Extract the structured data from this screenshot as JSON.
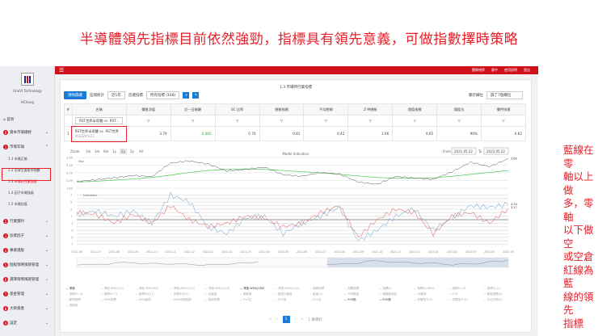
{
  "slide_title": "半導體領先指標目前依然強勁，指標具有領先意義，可做指數擇時策略",
  "annotation": [
    "藍線在零",
    "軸以上做",
    "多，零軸",
    "以下做空",
    "或空倉",
    "紅線為藍",
    "線的領先",
    "指標"
  ],
  "sidebar": {
    "company": "OneVI Technology",
    "user": "HChang",
    "home": "首頁",
    "items": [
      {
        "num": "0",
        "label": "資本市場總經"
      },
      {
        "num": "1",
        "label": "市場年報"
      },
      {
        "num": "2",
        "label": "行業獲利"
      },
      {
        "num": "3",
        "label": "投資因子"
      },
      {
        "num": "4",
        "label": "專業選股"
      },
      {
        "num": "5",
        "label": "個股策略風險管理"
      },
      {
        "num": "6",
        "label": "選擇策略風險管理"
      },
      {
        "num": "7",
        "label": "基金管理"
      },
      {
        "num": "8",
        "label": "大師資產"
      },
      {
        "num": "9",
        "label": "設定"
      }
    ],
    "subitems": [
      "1.1 市場正略",
      "1.2 全球主要股市指數",
      "1.3 市場時行業指標",
      "1.4 因子市場強弱",
      "1.5 市場估值"
    ]
  },
  "topbar": [
    "團隊視界",
    "客中",
    "使用說明",
    "登出"
  ],
  "panel": {
    "title": "1.3 市場時行業指標",
    "filter_button": "清除篩選",
    "period_label": "區間統計",
    "period_value": "近1年",
    "index_label": "首選指標",
    "index_value": "所有指標 (168)",
    "display_label": "顯示欄位",
    "display_value": "篩了7個欄位"
  },
  "table": {
    "headers": [
      "#",
      "名稱",
      "價格淨值",
      "近一日報酬",
      "SC 比率",
      "總報指標",
      "平均總報",
      "Z-M總報",
      "穩值指標",
      "擅值位",
      "擺件指標"
    ],
    "filter_value": "RST世界半導體 vs. RST...",
    "row": {
      "index": "1",
      "name": "RST世界半導體 vs. RST世界",
      "date": "2023/05/22",
      "values": [
        "3.79",
        "0.085",
        "0.70",
        "0.81",
        "0.42",
        "1.06",
        "0.65",
        "90%",
        "0.62"
      ]
    }
  },
  "chart_toolbar": {
    "zoom_label": "Zoom",
    "ranges": [
      "1m",
      "3m",
      "6m",
      "1y",
      "2y",
      "3y",
      "All"
    ],
    "title": "Model Indicators",
    "from_label": "From",
    "from": "2021.05.22",
    "to_label": "To",
    "to": "2023.05.22"
  },
  "chart_data": {
    "type": "line",
    "x": [
      "2021-06",
      "2021-07",
      "2021-08",
      "2021-09",
      "2021-10",
      "2021-11",
      "2021-12",
      "2022-01",
      "2022-02",
      "2022-03",
      "2022-04",
      "2022-05",
      "2022-06",
      "2022-07",
      "2022-08",
      "2022-09",
      "2022-10",
      "2022-11",
      "2022-12",
      "2023-01",
      "2023-02",
      "2023-03",
      "2023-04",
      "2023-05"
    ],
    "nav_label": "Nav",
    "nav_yticks": [
      "2.69",
      "2.49",
      "2.29",
      "2.09",
      "1.89"
    ],
    "nav_ylim": [
      1.89,
      2.69
    ],
    "nav_last": "2.65",
    "nav": [
      2.06,
      2.11,
      2.16,
      2.22,
      2.19,
      2.55,
      2.6,
      2.52,
      2.34,
      2.38,
      2.44,
      2.24,
      2.2,
      2.3,
      2.26,
      2.05,
      1.99,
      2.2,
      2.15,
      2.12,
      2.32,
      2.57,
      2.45,
      2.66
    ],
    "nav_ma": [
      2.05,
      2.07,
      2.1,
      2.13,
      2.17,
      2.23,
      2.3,
      2.35,
      2.38,
      2.39,
      2.38,
      2.35,
      2.32,
      2.29,
      2.25,
      2.21,
      2.17,
      2.15,
      2.15,
      2.16,
      2.2,
      2.25,
      2.3,
      2.35
    ],
    "ind_label": "Indicators",
    "ind_yticks": [
      "7",
      "5",
      "3",
      "1",
      "-1",
      "-3",
      "-5",
      "-7"
    ],
    "ind_ylim": [
      -8,
      8
    ],
    "blue_last": "4.34",
    "red_last": "3.17",
    "blue": [
      1.5,
      2.5,
      1,
      2.5,
      -1,
      7,
      5,
      -2,
      -4,
      0.5,
      1,
      -4,
      -1,
      1,
      3.5,
      -6,
      -3,
      1,
      3,
      -3,
      0.5,
      4,
      3.5,
      4.34
    ],
    "red": [
      2,
      1.5,
      -1,
      1.5,
      -1,
      4,
      0,
      -2,
      -1,
      1,
      0.5,
      -2,
      -1,
      2,
      4,
      -5,
      0,
      3,
      2,
      -4,
      1,
      2,
      -1,
      3.17
    ]
  },
  "legend": [
    "淨值",
    "淨值 WMA(20)",
    "淨值 WMA(60)",
    "淨值 WMA(120)",
    "淨值 WMA(120)",
    "淨值 WMA(180)",
    "淨值 WMA(250)",
    "總報指標",
    "相關指標",
    "指標Zs",
    "指標Zs WMA",
    "指標Zs 20",
    "指標Zs 21",
    "指標Zs 34",
    "指標Zs 71",
    "指標中位(1)",
    "指標中位(2)",
    "加速度",
    "動能值",
    "動量加速度",
    "動量(U)",
    "不同動量",
    "總報動量值",
    "Zs動態",
    "EVS",
    "動能指標(K)",
    "動態指標",
    "DMA指標",
    "DMA動態",
    "DMA信號趨勢",
    "趨勢指標",
    "EVS正",
    "EVS差",
    "EVS反",
    "EVS指",
    "EVS值",
    "供需指下(U)",
    "供需指下(D)",
    "平台空間(U)",
    "週期值"
  ],
  "pager": {
    "current": "1",
    "summary": "1 筆資料"
  }
}
